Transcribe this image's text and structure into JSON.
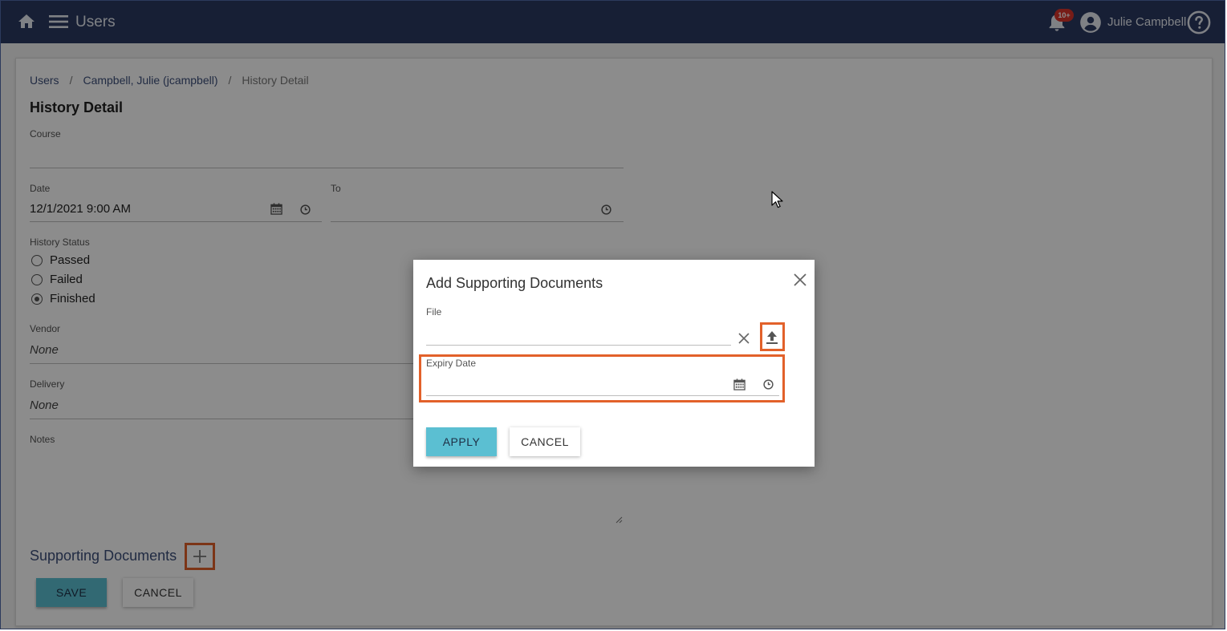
{
  "topbar": {
    "title": "Users",
    "notification_badge": "10+",
    "user_name": "Julie Campbell"
  },
  "breadcrumb": {
    "items": [
      "Users",
      "Campbell, Julie (jcampbell)",
      "History Detail"
    ],
    "separator": "/"
  },
  "page": {
    "title": "History Detail",
    "course_label": "Course",
    "course_value": "",
    "date_label": "Date",
    "date_value": "12/1/2021 9:00 AM",
    "to_label": "To",
    "to_value": "",
    "history_status_label": "History Status",
    "status_options": [
      {
        "label": "Passed",
        "selected": false
      },
      {
        "label": "Failed",
        "selected": false
      },
      {
        "label": "Finished",
        "selected": true
      }
    ],
    "vendor_label": "Vendor",
    "vendor_value": "None",
    "delivery_label": "Delivery",
    "delivery_value": "None",
    "notes_label": "Notes",
    "supporting_documents_label": "Supporting Documents",
    "save_label": "SAVE",
    "cancel_label": "CANCEL"
  },
  "dialog": {
    "title": "Add Supporting Documents",
    "file_label": "File",
    "file_value": "",
    "expiry_label": "Expiry Date",
    "expiry_value": "",
    "apply_label": "APPLY",
    "cancel_label": "CANCEL"
  },
  "colors": {
    "topbar": "#2b3a62",
    "primary_button": "#5bbfd2",
    "highlight": "#e2612a",
    "badge": "#d9332b",
    "link": "#3d4f7a"
  }
}
